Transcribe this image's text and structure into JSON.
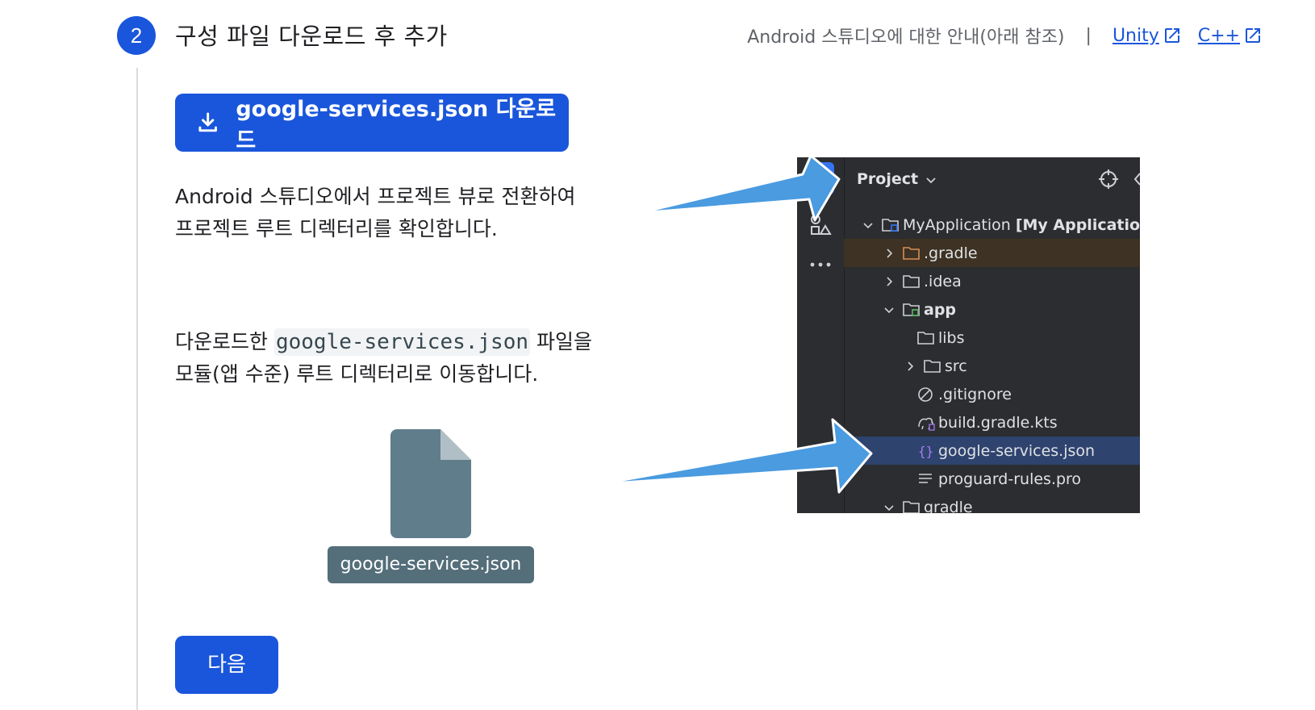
{
  "step": {
    "number": "2",
    "title": "구성 파일 다운로드 후 추가"
  },
  "guide": {
    "text": "Android 스튜디오에 대한 안내(아래 참조)",
    "separator": "|",
    "links": [
      {
        "label": "Unity",
        "icon": "external-link-icon"
      },
      {
        "label": "C++",
        "icon": "external-link-icon"
      }
    ]
  },
  "download_button": {
    "label": "google-services.json 다운로드",
    "icon": "download-icon"
  },
  "instructions": {
    "first_line1": "Android 스튜디오에서 프로젝트 뷰로 전환하여",
    "first_line2": "프로젝트 루트 디렉터리를 확인합니다.",
    "second_prefix": "다운로드한 ",
    "second_code": "google-services.json",
    "second_suffix": " 파일을",
    "second_line2": "모듈(앱 수준) 루트 디렉터리로 이동합니다."
  },
  "file_chip": {
    "label": "google-services.json"
  },
  "next_button": {
    "label": "다음"
  },
  "ide": {
    "panel_title": "Project",
    "tree": [
      {
        "name": "MyApplication",
        "suffix": "[My Application]",
        "expanded": true
      },
      {
        "name": ".gradle",
        "expanded": false
      },
      {
        "name": ".idea",
        "expanded": false
      },
      {
        "name": "app",
        "expanded": true
      },
      {
        "name": "libs"
      },
      {
        "name": "src",
        "expanded": false
      },
      {
        "name": ".gitignore"
      },
      {
        "name": "build.gradle.kts"
      },
      {
        "name": "google-services.json"
      },
      {
        "name": "proguard-rules.pro"
      },
      {
        "name": "gradle",
        "expanded": true
      }
    ]
  },
  "colors": {
    "primary": "#1a56db",
    "ide_bg": "#2b2d30",
    "arrow": "#4a9be0",
    "chip": "#546e7a"
  }
}
